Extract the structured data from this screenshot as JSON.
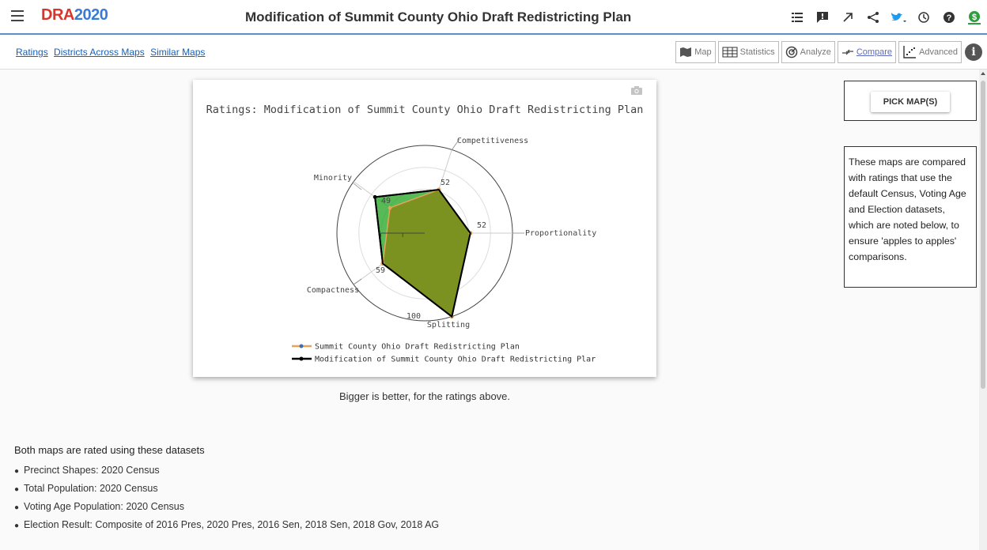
{
  "header": {
    "logo_prefix": "DRA",
    "logo_year": "2020",
    "title": "Modification of Summit County Ohio Draft Redistricting Plan",
    "icons": [
      "list-icon",
      "feedback-icon",
      "expand-icon",
      "share-icon",
      "twitter-icon",
      "history-icon",
      "help-icon",
      "dollar-icon"
    ]
  },
  "subbar": {
    "links": [
      "Ratings",
      "Districts Across Maps",
      "Similar Maps"
    ],
    "views": [
      {
        "label": "Map",
        "icon": "map-icon"
      },
      {
        "label": "Statistics",
        "icon": "table-icon"
      },
      {
        "label": "Analyze",
        "icon": "analyze-icon"
      },
      {
        "label": "Compare",
        "icon": "compare-icon",
        "active": true
      },
      {
        "label": "Advanced",
        "icon": "scatter-icon"
      }
    ]
  },
  "chart_data": {
    "type": "radar",
    "title": "Ratings: Modification of  Summit County Ohio Draft Redistricting Plan",
    "axes": [
      "Proportionality",
      "Competitiveness",
      "Minority",
      "Compactness",
      "Splitting"
    ],
    "range": [
      0,
      100
    ],
    "series": [
      {
        "name": "Summit County Ohio Draft Redistricting Plan",
        "color": "#e8a35a",
        "values": [
          52,
          52,
          49,
          59,
          100
        ]
      },
      {
        "name": "Modification of  Summit County Ohio Draft Redistricting Plar",
        "color": "#000000",
        "values": [
          52,
          52,
          70,
          59,
          100
        ]
      }
    ],
    "value_labels": [
      "52",
      "52",
      "49",
      "59",
      "100"
    ],
    "fill_colors": {
      "series1": "#7d8f1e",
      "series2": "#1fa31f"
    }
  },
  "caption": "Bigger is better, for the ratings above.",
  "right_panel": {
    "pick_button": "PICK MAP(S)",
    "note": "These maps are compared with ratings that use the default Census, Voting Age and Election datasets, which are noted below, to ensure 'apples to apples' comparisons."
  },
  "datasets": {
    "heading": "Both maps are rated using these datasets",
    "items": [
      "Precinct Shapes: 2020 Census",
      "Total Population: 2020 Census",
      "Voting Age Population: 2020 Census",
      "Election Result: Composite of 2016 Pres, 2020 Pres, 2016 Sen, 2018 Sen, 2018 Gov, 2018 AG"
    ]
  }
}
